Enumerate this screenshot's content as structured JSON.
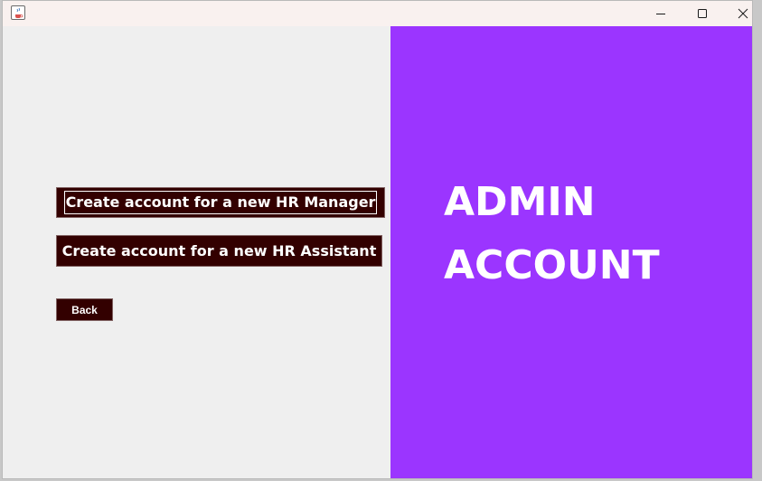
{
  "window": {
    "icon": "java-cup-icon",
    "controls": [
      "minimize-icon",
      "maximize-icon",
      "close-icon"
    ]
  },
  "left_panel": {
    "buttons": {
      "hr_manager": "Create account for  a new HR Manager",
      "hr_assistant": "Create account for a new HR Assistant",
      "back": "Back"
    }
  },
  "right_panel": {
    "title_line1": "ADMIN",
    "title_line2": "ACCOUNT",
    "background": "#9b35ff"
  },
  "colors": {
    "button_bg": "#330000",
    "button_text": "#ffffff",
    "panel_bg": "#efefef"
  }
}
